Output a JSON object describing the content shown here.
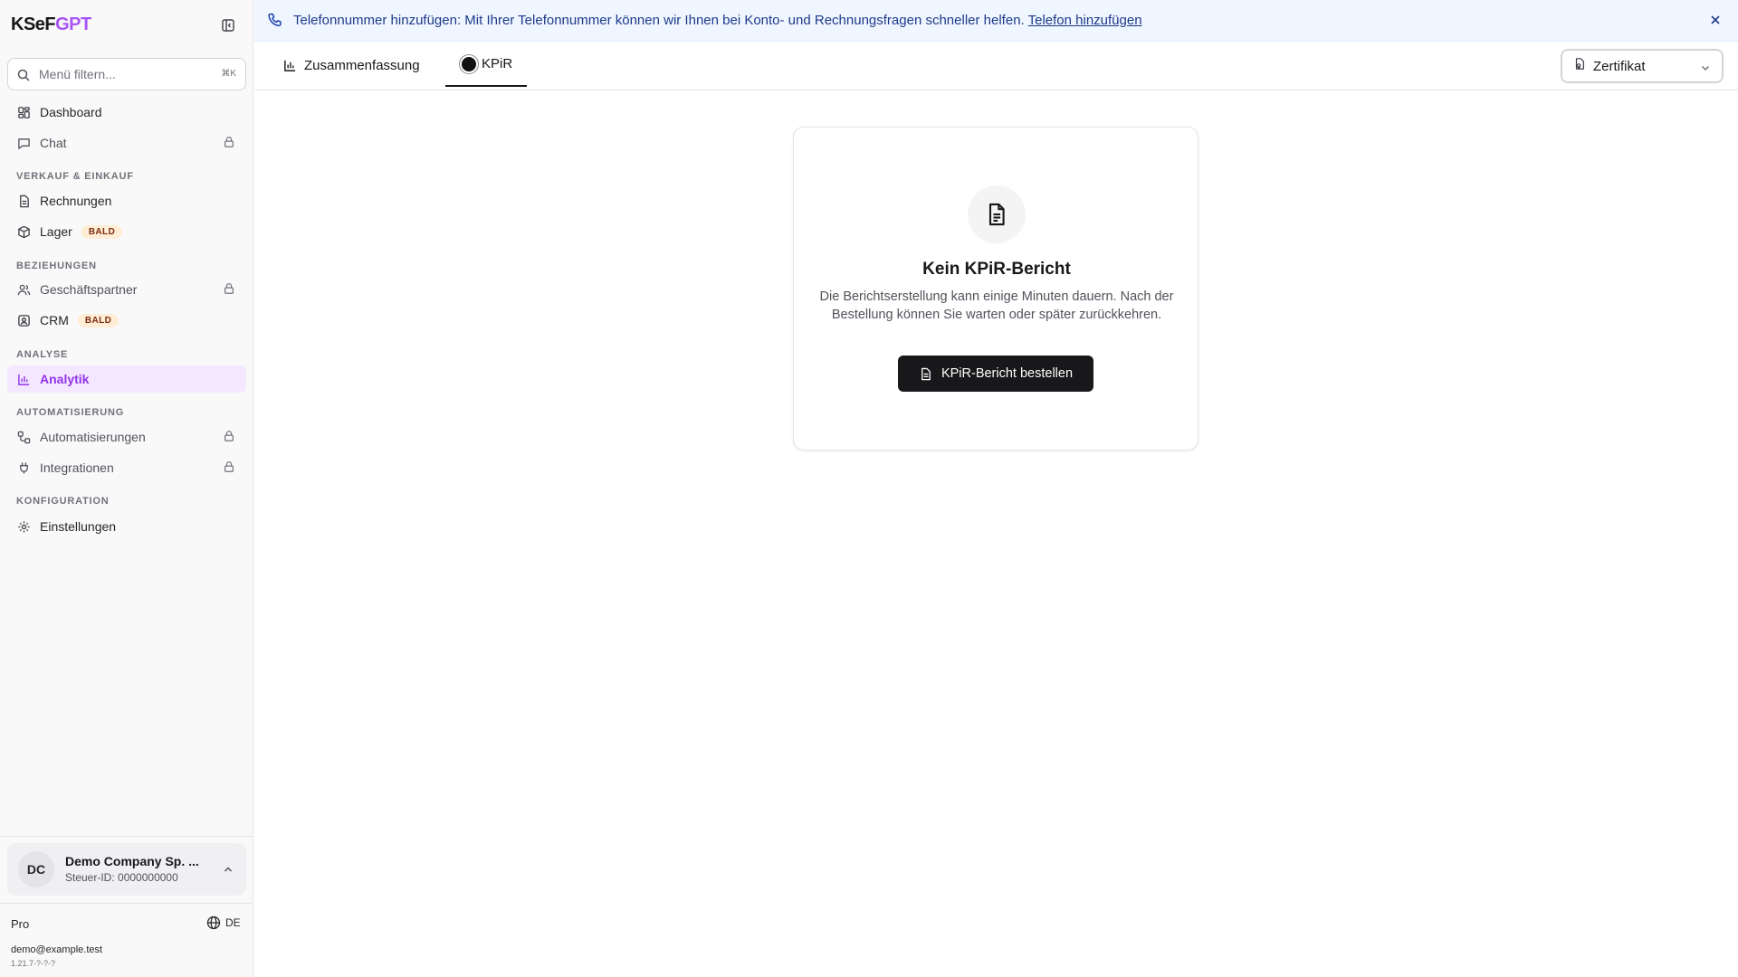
{
  "app": {
    "logo_part1": "KSeF",
    "logo_part2": "GPT"
  },
  "sidebar": {
    "filter_placeholder": "Menü filtern...",
    "filter_shortcut": "⌘K",
    "items": [
      {
        "label": "Dashboard"
      },
      {
        "label": "Chat"
      },
      {
        "label": "Rechnungen"
      },
      {
        "label": "Lager",
        "badge": "BALD"
      },
      {
        "label": "Geschäftspartner"
      },
      {
        "label": "CRM",
        "badge": "BALD"
      },
      {
        "label": "Analytik"
      },
      {
        "label": "Automatisierungen"
      },
      {
        "label": "Integrationen"
      },
      {
        "label": "Einstellungen"
      }
    ],
    "sections": {
      "sales": "VERKAUF & EINKAUF",
      "relations": "BEZIEHUNGEN",
      "analysis": "ANALYSE",
      "automation": "AUTOMATISIERUNG",
      "config": "KONFIGURATION"
    },
    "company": {
      "initials": "DC",
      "name": "Demo Company Sp. ...",
      "tax_id": "Steuer-ID: 0000000000"
    },
    "plan": "Pro",
    "language": "DE",
    "email": "demo@example.test",
    "version": "1.21.7-?-?-?"
  },
  "banner": {
    "text": "Telefonnummer hinzufügen: Mit Ihrer Telefonnummer können wir Ihnen bei Konto- und Rechnungsfragen schneller helfen.",
    "link": "Telefon hinzufügen"
  },
  "tabs": [
    {
      "label": "Zusammenfassung"
    },
    {
      "label": "KPiR"
    }
  ],
  "certificate_select": {
    "value": "Zertifikat"
  },
  "empty_state": {
    "title": "Kein KPiR-Bericht",
    "description": "Die Berichtserstellung kann einige Minuten dauern. Nach der Bestellung können Sie warten oder später zurückkehren.",
    "button": "KPiR-Bericht bestellen"
  },
  "colors": {
    "accent": "#9333ea",
    "active_bg": "#f3e8ff",
    "banner_bg": "#eff6ff",
    "primary_button": "#18181b"
  }
}
